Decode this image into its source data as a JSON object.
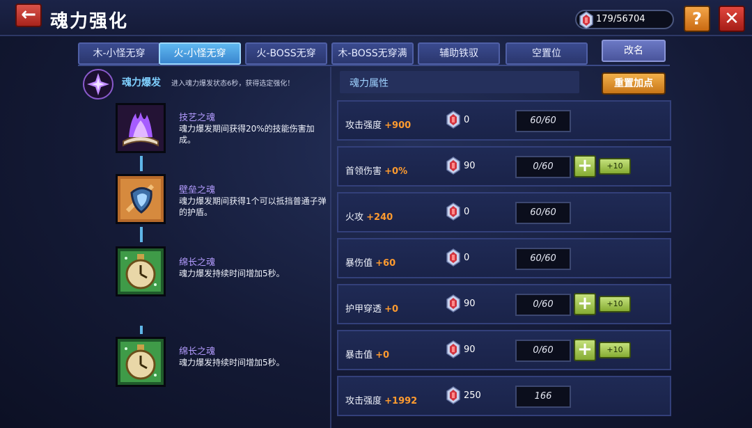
{
  "header": {
    "back_label": "←",
    "title": "魂力强化",
    "currency": "179/56704",
    "help_label": "?",
    "close_label": "✕"
  },
  "tabs": [
    {
      "label": "木-小怪无穿",
      "active": false
    },
    {
      "label": "火-小怪无穿",
      "active": true
    },
    {
      "label": "火-BOSS无穿",
      "active": false
    },
    {
      "label": "木-BOSS无穿满",
      "active": false
    },
    {
      "label": "辅助铁驭",
      "active": false
    },
    {
      "label": "空置位",
      "active": false
    }
  ],
  "rename_label": "改名",
  "burst": {
    "title": "魂力爆发",
    "desc": "进入魂力爆发状态6秒，获得选定强化！"
  },
  "talents": [
    {
      "name": "技艺之魂",
      "desc": "魂力爆发期间获得20%的技能伤害加成。",
      "icon": "purple-flame-book-icon"
    },
    {
      "name": "壁垒之魂",
      "desc": "魂力爆发期间获得1个可以抵挡普通子弹的护盾。",
      "icon": "shield-barrier-icon"
    },
    {
      "name": "绵长之魂",
      "desc": "魂力爆发持续时间增加5秒。",
      "icon": "clock-timer-icon"
    },
    {
      "name": "绵长之魂",
      "desc": "魂力爆发持续时间增加5秒。",
      "icon": "clock-timer-icon"
    }
  ],
  "attributes": {
    "header": "魂力属性",
    "reset_label": "重置加点",
    "plus_label": "+",
    "plus10_label": "+10",
    "rows": [
      {
        "name": "攻击强度",
        "bonus": "+900",
        "cost": "0",
        "progress": "60/60",
        "upgradable": false
      },
      {
        "name": "首领伤害",
        "bonus": "+0%",
        "cost": "90",
        "progress": "0/60",
        "upgradable": true
      },
      {
        "name": "火攻",
        "bonus": "+240",
        "cost": "0",
        "progress": "60/60",
        "upgradable": false
      },
      {
        "name": "暴伤值",
        "bonus": "+60",
        "cost": "0",
        "progress": "60/60",
        "upgradable": false
      },
      {
        "name": "护甲穿透",
        "bonus": "+0",
        "cost": "90",
        "progress": "0/60",
        "upgradable": true
      },
      {
        "name": "暴击值",
        "bonus": "+0",
        "cost": "90",
        "progress": "0/60",
        "upgradable": true
      },
      {
        "name": "攻击强度",
        "bonus": "+1992",
        "cost": "250",
        "progress": "166",
        "upgradable": false
      }
    ]
  },
  "colors": {
    "bonus": "#ff9b2f",
    "talent_name": "#b49cff",
    "active_tab": "#4aa0e0",
    "connector": "#5fb6e8"
  }
}
